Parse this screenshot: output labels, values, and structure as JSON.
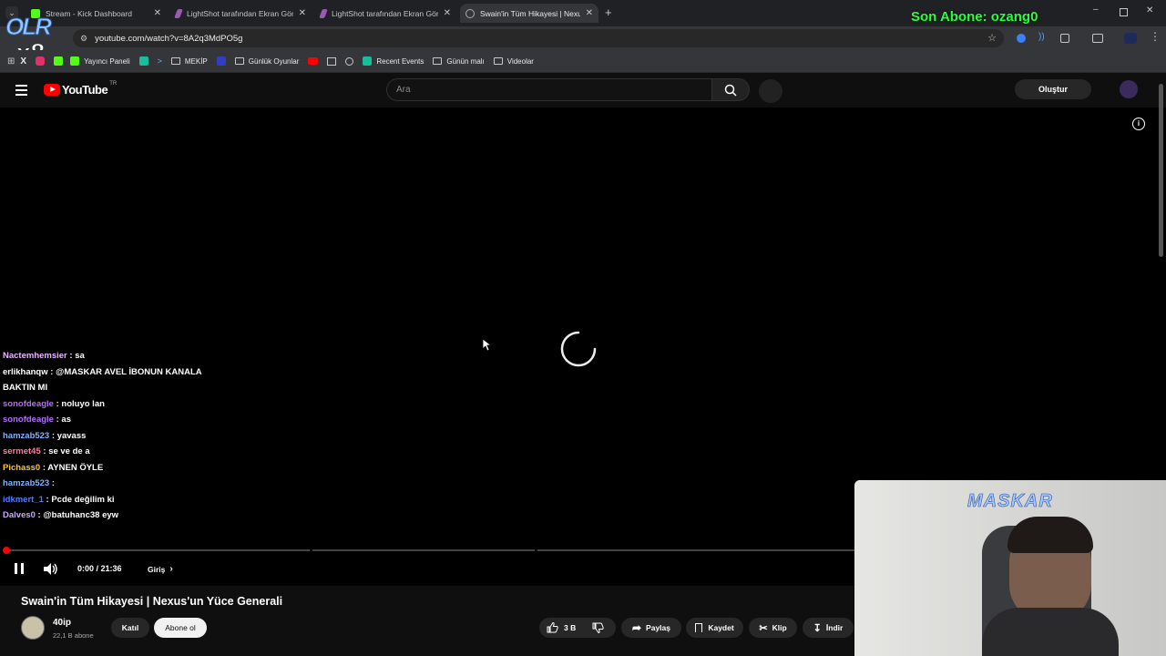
{
  "browser": {
    "tabs": [
      {
        "title": "Stream - Kick Dashboard",
        "color": "#53fc18"
      },
      {
        "title": "LightShot tarafından Ekran Gör",
        "color": "#9b59b6"
      },
      {
        "title": "LightShot tarafından Ekran Gör",
        "color": "#9b59b6"
      },
      {
        "title": "Swain'in Tüm Hikayesi | Nexus'",
        "color": "#888888"
      }
    ],
    "url": "youtube.com/watch?v=8A2q3MdPO5g",
    "bookmarks": [
      {
        "label": "Yayıncı Paneli",
        "kind": "icon",
        "color": "#53fc18"
      },
      {
        "label": "MEKİP",
        "kind": "folder"
      },
      {
        "label": "Günlük Oyunlar",
        "kind": "folder"
      },
      {
        "label": "Recent Events",
        "kind": "icon",
        "color": "#1abc9c"
      },
      {
        "label": "Günün malı",
        "kind": "folder"
      },
      {
        "label": "Videolar",
        "kind": "folder"
      }
    ]
  },
  "overlay": {
    "sub_label": "Son Abone: ozang0",
    "logo_text": "OLR",
    "logo_x8": "x8",
    "cam_name": "MASKAR"
  },
  "youtube": {
    "logo": "YouTube",
    "region": "TR",
    "search_placeholder": "Ara",
    "create_label": "Oluştur"
  },
  "chat": [
    {
      "user": "Nactemhemsier",
      "msg": "sa",
      "color": "#e8b8ff"
    },
    {
      "user": "erlikhanqw",
      "msg": "@MASKAR AVEL İBONUN KANALA",
      "color": "#ffffff"
    },
    {
      "user": "",
      "msg": "BAKTIN MI",
      "color": "#ffffff"
    },
    {
      "user": "sonofdeagle",
      "msg": "noluyo lan",
      "color": "#b56bff"
    },
    {
      "user": "sonofdeagle",
      "msg": "as",
      "color": "#b56bff"
    },
    {
      "user": "hamzab523",
      "msg": "yavass",
      "color": "#7fb3ff"
    },
    {
      "user": "sermet45",
      "msg": "se ve de a",
      "color": "#ff7aa2"
    },
    {
      "user": "Pichass0",
      "msg": "AYNEN ÖYLE",
      "color": "#f5c542"
    },
    {
      "user": "hamzab523",
      "msg": "",
      "color": "#7fb3ff"
    },
    {
      "user": "idkmert_1",
      "msg": "Pcde değilim ki",
      "color": "#4f7dff"
    },
    {
      "user": "Dalves0",
      "msg": "@batuhanc38 eyw",
      "color": "#c9a8ff"
    }
  ],
  "player": {
    "time": "0:00 / 21:36",
    "chapter": "Giriş",
    "progress": 0.0
  },
  "video": {
    "title": "Swain'in Tüm Hikayesi | Nexus'un Yüce Generali",
    "channel": "40ip",
    "subscribers": "22,1 B abone",
    "join": "Katıl",
    "subscribe": "Abone ol",
    "likes": "3 B",
    "share": "Paylaş",
    "save": "Kaydet",
    "clip": "Klip",
    "download": "İndir"
  }
}
